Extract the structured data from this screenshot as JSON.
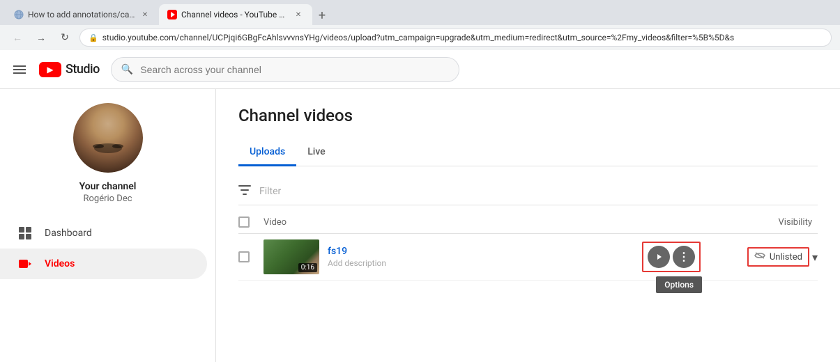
{
  "browser": {
    "tabs": [
      {
        "id": "tab1",
        "title": "How to add annotations/cards/e",
        "favicon_type": "cloud",
        "active": false
      },
      {
        "id": "tab2",
        "title": "Channel videos - YouTube Studio",
        "favicon_type": "youtube",
        "active": true
      }
    ],
    "new_tab_label": "+",
    "address": "studio.youtube.com/channel/UCPjqi6GBgFcAhlsvvvnsYHg/videos/upload?utm_campaign=upgrade&utm_medium=redirect&utm_source=%2Fmy_videos&filter=%5B%5D&s"
  },
  "topbar": {
    "menu_label": "Menu",
    "logo_text": "Studio",
    "search_placeholder": "Search across your channel"
  },
  "sidebar": {
    "channel_label": "Your channel",
    "channel_handle": "Rogério Dec",
    "items": [
      {
        "id": "dashboard",
        "label": "Dashboard",
        "icon": "grid"
      },
      {
        "id": "videos",
        "label": "Videos",
        "icon": "video",
        "active": true
      }
    ]
  },
  "content": {
    "page_title": "Channel videos",
    "tabs": [
      {
        "id": "uploads",
        "label": "Uploads",
        "active": true
      },
      {
        "id": "live",
        "label": "Live",
        "active": false
      }
    ],
    "filter_placeholder": "Filter",
    "table": {
      "header": {
        "video_col": "Video",
        "visibility_col": "Visibility"
      },
      "rows": [
        {
          "id": "row1",
          "title": "fs19",
          "description": "Add description",
          "thumb_duration": "0:16",
          "visibility": "Unlisted",
          "actions": {
            "watch_label": "Watch on YouTube",
            "more_label": "More options",
            "tooltip": "Options"
          }
        }
      ]
    }
  },
  "icons": {
    "menu": "☰",
    "search": "🔍",
    "lock": "🔒",
    "back": "←",
    "forward": "→",
    "refresh": "↻",
    "filter": "≡",
    "eye_slash": "👁",
    "dropdown_arrow": "▾",
    "yt_play": "▶",
    "more_vert": "⋮",
    "grid": "⊞"
  },
  "colors": {
    "active_tab": "#065fd4",
    "red": "#ff0000",
    "border_red": "#e53935"
  }
}
